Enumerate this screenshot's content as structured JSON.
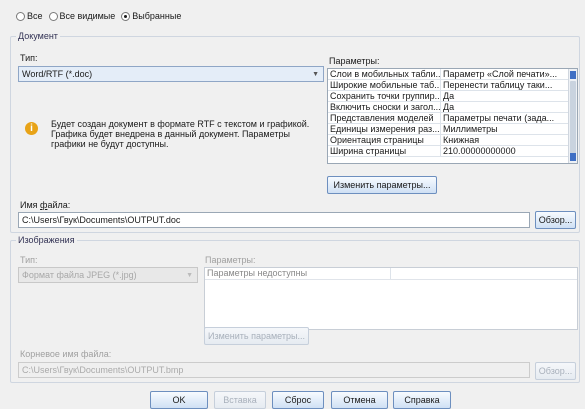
{
  "scope": {
    "options": [
      {
        "label": "Все",
        "selected": false
      },
      {
        "label": "Все видимые",
        "selected": false
      },
      {
        "label": "Выбранные",
        "selected": true
      }
    ]
  },
  "document": {
    "group_label": "Документ",
    "type_label": "Тип:",
    "type_value": "Word/RTF (*.doc)",
    "info_text_1": "Будет создан документ в формате RTF с текстом и графикой.",
    "info_text_2": "Графика будет внедрена в данный документ. Параметры",
    "info_text_3": "графики не будут доступны.",
    "params_label": "Параметры:",
    "params": [
      {
        "name": "Слои в мобильных табли...",
        "value": "Параметр «Слой печати»..."
      },
      {
        "name": "Широкие мобильные таб...",
        "value": "Перенести таблицу таки..."
      },
      {
        "name": "Сохранить точки группир...",
        "value": "Да"
      },
      {
        "name": "Включить сноски и загол...",
        "value": "Да"
      },
      {
        "name": "Представления моделей",
        "value": "Параметры печати (зада..."
      },
      {
        "name": "Единицы измерения раз...",
        "value": "Миллиметры"
      },
      {
        "name": "Ориентация страницы",
        "value": "Книжная"
      },
      {
        "name": "Ширина страницы",
        "value": "210.00000000000"
      }
    ],
    "change_params_button": "Изменить параметры...",
    "filename_label": "Имя файла:",
    "filename_value": "C:\\Users\\Гвук\\Documents\\OUTPUT.doc",
    "browse_button": "Обзор..."
  },
  "images": {
    "group_label": "Изображения",
    "type_label": "Тип:",
    "type_value": "Формат файла JPEG (*.jpg)",
    "params_label": "Параметры:",
    "params_unavailable": "Параметры недоступны",
    "change_params_button": "Изменить параметры...",
    "root_filename_label": "Корневое имя файла:",
    "root_filename_value": "C:\\Users\\Гвук\\Documents\\OUTPUT.bmp",
    "browse_button": "Обзор..."
  },
  "footer": {
    "ok": "OK",
    "paste": "Вставка",
    "reset": "Сброс",
    "cancel": "Отмена",
    "help": "Справка"
  }
}
